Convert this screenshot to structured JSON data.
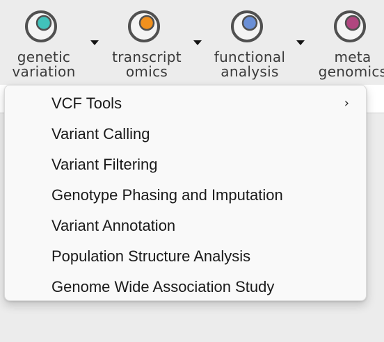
{
  "toolbar": {
    "buttons": [
      {
        "line1": "genetic",
        "line2": "variation",
        "icon": "teal-circle-icon",
        "color": "#41c2bb",
        "has_dropdown": true
      },
      {
        "line1": "transcript",
        "line2": "omics",
        "icon": "orange-circle-icon",
        "color": "#f0901e",
        "has_dropdown": true
      },
      {
        "line1": "functional",
        "line2": "analysis",
        "icon": "blue-circle-icon",
        "color": "#6a8fd6",
        "has_dropdown": true
      },
      {
        "line1": "meta",
        "line2": "genomics",
        "icon": "magenta-circle-icon",
        "color": "#b0467f",
        "has_dropdown": false
      }
    ]
  },
  "menu": {
    "items": [
      {
        "label": "VCF Tools",
        "submenu": true
      },
      {
        "label": "Variant Calling",
        "submenu": false
      },
      {
        "label": "Variant Filtering",
        "submenu": false
      },
      {
        "label": "Genotype Phasing and Imputation",
        "submenu": false
      },
      {
        "label": "Variant Annotation",
        "submenu": false
      },
      {
        "label": "Population Structure Analysis",
        "submenu": false
      },
      {
        "label": "Genome Wide Association Study",
        "submenu": false
      }
    ],
    "submenu_glyph": "›"
  }
}
